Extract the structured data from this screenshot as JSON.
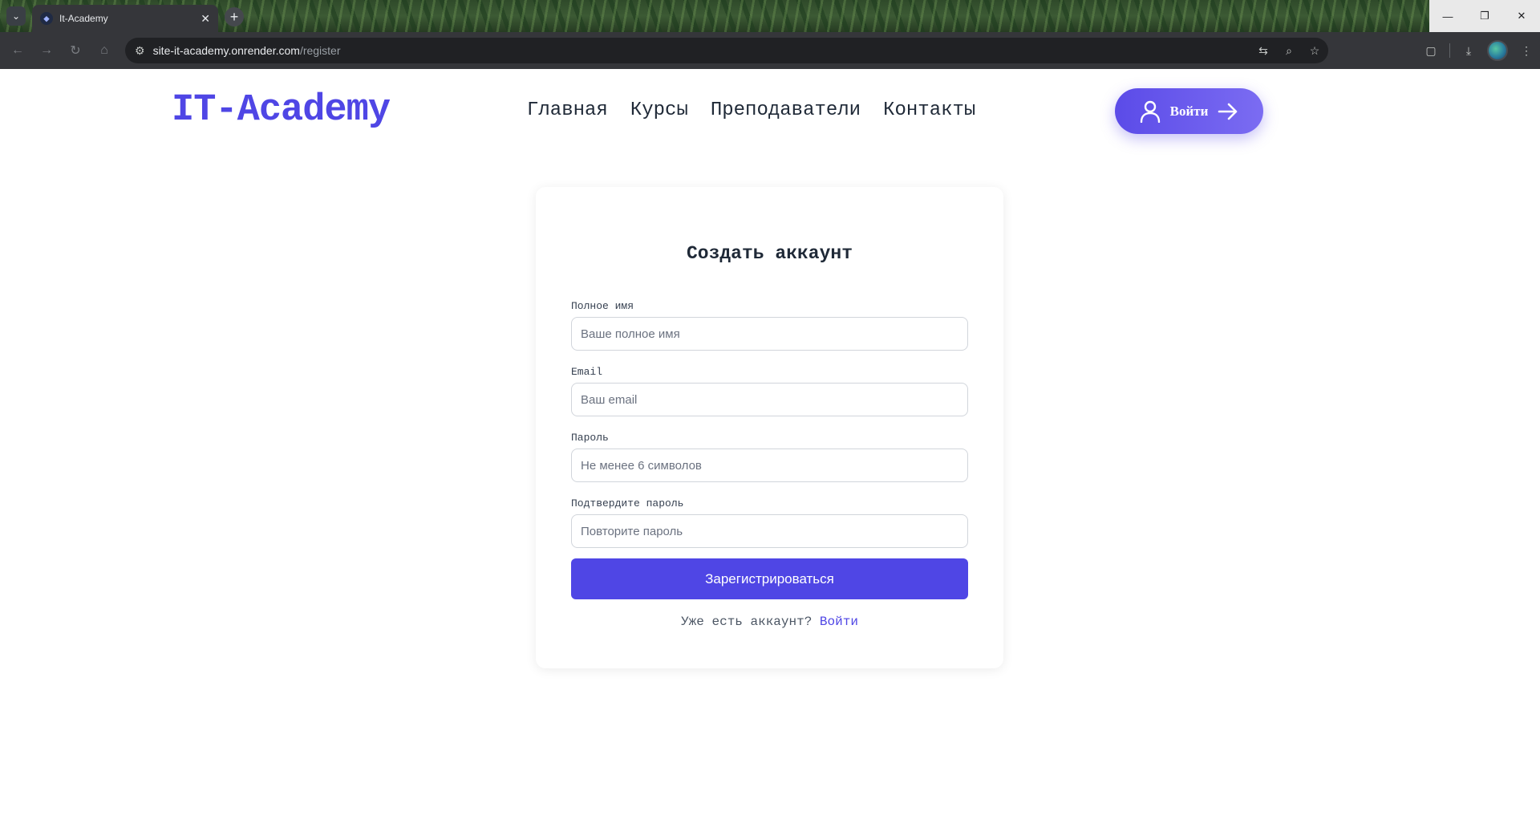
{
  "browser": {
    "tab_title": "It-Academy",
    "url_host": "site-it-academy.onrender.com",
    "url_path": "/register",
    "icons": {
      "tab_menu": "chevron-down-icon",
      "tab_close": "close-icon",
      "new_tab": "plus-icon",
      "back": "back-arrow-icon",
      "forward": "forward-arrow-icon",
      "reload": "reload-icon",
      "home": "home-icon",
      "site_info": "site-info-icon",
      "translate": "translate-icon",
      "zoom": "zoom-icon",
      "bookmark": "star-icon",
      "extensions": "puzzle-icon",
      "downloads": "download-icon",
      "menu": "kebab-menu-icon",
      "minimize": "minimize-icon",
      "restore": "restore-icon",
      "close": "close-window-icon"
    }
  },
  "header": {
    "logo": "IT-Academy",
    "nav": [
      "Главная",
      "Курсы",
      "Преподаватели",
      "Контакты"
    ],
    "login_label": "Войти"
  },
  "form": {
    "title": "Создать аккаунт",
    "fields": [
      {
        "label": "Полное имя",
        "placeholder": "Ваше полное имя",
        "value": ""
      },
      {
        "label": "Email",
        "placeholder": "Ваш email",
        "value": ""
      },
      {
        "label": "Пароль",
        "placeholder": "Не менее 6 символов",
        "value": ""
      },
      {
        "label": "Подтвердите пароль",
        "placeholder": "Повторите пароль",
        "value": ""
      }
    ],
    "submit_label": "Зарегистрироваться",
    "signin_prompt": "Уже есть аккаунт?",
    "signin_link": "Войти"
  },
  "colors": {
    "accent": "#4f46e5",
    "accent_light": "#7b6cf2",
    "text_dark": "#1f2937",
    "chrome_bg": "#35363a"
  }
}
